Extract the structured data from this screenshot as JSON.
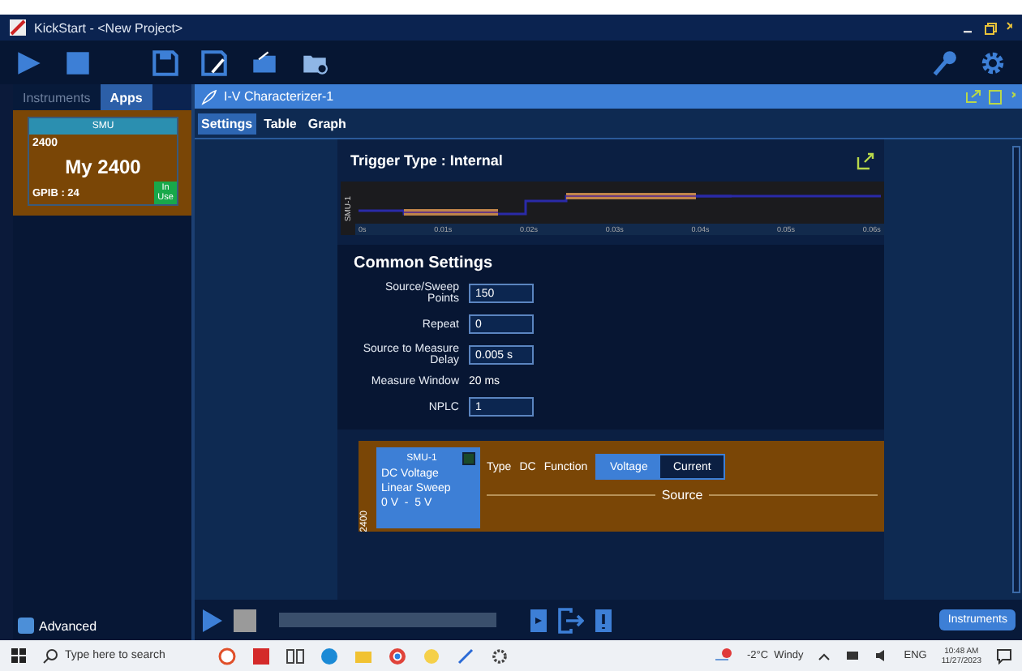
{
  "window": {
    "title": "KickStart - <New Project>"
  },
  "sidebar": {
    "tabs": [
      {
        "label": "Instruments",
        "selected": false
      },
      {
        "label": "Apps",
        "selected": true
      }
    ],
    "instrument": {
      "type": "SMU",
      "model": "2400",
      "name": "My 2400",
      "address": "GPIB : 24",
      "status": "In Use"
    },
    "advanced": "Advanced"
  },
  "panel": {
    "title": "I-V Characterizer-1",
    "tabs": [
      {
        "label": "Settings",
        "selected": true
      },
      {
        "label": "Table",
        "selected": false
      },
      {
        "label": "Graph",
        "selected": false
      }
    ]
  },
  "trigger": {
    "label": "Trigger Type :  Internal",
    "channel": "SMU-1",
    "time_labels": [
      "0s",
      "0.01s",
      "0.02s",
      "0.03s",
      "0.04s",
      "0.05s",
      "0.06s"
    ]
  },
  "common_settings": {
    "title": "Common Settings",
    "fields": [
      {
        "kind": "input",
        "label": "Source/Sweep Points",
        "value": "150"
      },
      {
        "kind": "input",
        "label": "Repeat",
        "value": "0"
      },
      {
        "kind": "input",
        "label": "Source to Measure Delay",
        "value": "0.005 s"
      },
      {
        "kind": "text",
        "label": "Measure Window",
        "value": "20 ms"
      },
      {
        "kind": "input",
        "label": "NPLC",
        "value": "1"
      }
    ]
  },
  "device": {
    "model": "2400",
    "card": {
      "name": "SMU-1",
      "checked": true,
      "lines": [
        "DC Voltage",
        "Linear Sweep",
        "0 V  -  5 V"
      ]
    },
    "type_label": "Type",
    "type_value": "DC",
    "function_label": "Function",
    "functions": [
      {
        "label": "Voltage",
        "selected": true
      },
      {
        "label": "Current",
        "selected": false
      }
    ],
    "section": "Source"
  },
  "bottom_bar": {
    "button": "Instruments"
  },
  "taskbar": {
    "search_placeholder": "Type here to search",
    "weather": "-2°C  Windy",
    "language": "ENG",
    "time": "10:48 AM",
    "date": "11/27/2023"
  }
}
